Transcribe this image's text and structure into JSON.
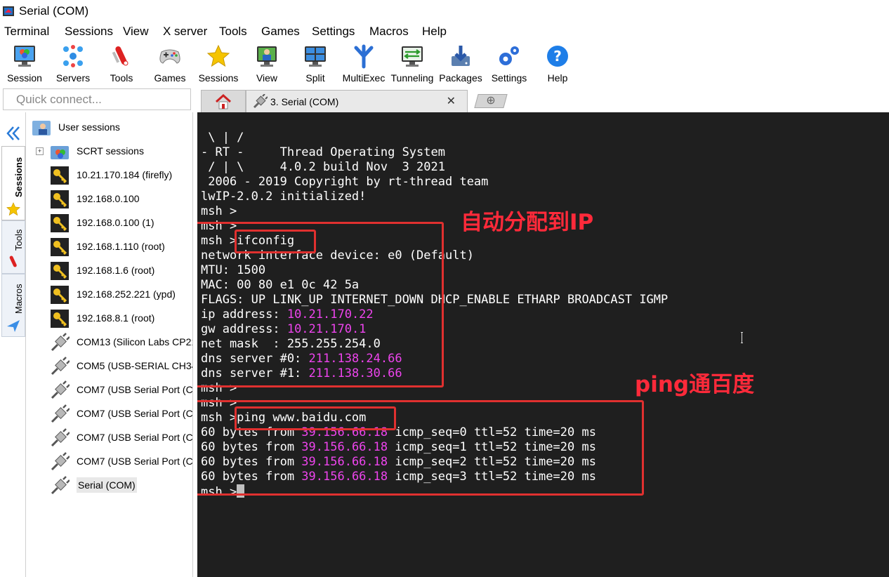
{
  "window": {
    "title": "Serial (COM)"
  },
  "menu": [
    "Terminal",
    "Sessions",
    "View",
    "X server",
    "Tools",
    "Games",
    "Settings",
    "Macros",
    "Help"
  ],
  "toolbar": [
    {
      "label": "Session",
      "icon": "monitor-icon"
    },
    {
      "label": "Servers",
      "icon": "servers-icon"
    },
    {
      "label": "Tools",
      "icon": "tools-icon"
    },
    {
      "label": "Games",
      "icon": "gamepad-icon"
    },
    {
      "label": "Sessions",
      "icon": "star-icon"
    },
    {
      "label": "View",
      "icon": "view-icon"
    },
    {
      "label": "Split",
      "icon": "split-icon"
    },
    {
      "label": "MultiExec",
      "icon": "multiexec-icon"
    },
    {
      "label": "Tunneling",
      "icon": "tunneling-icon"
    },
    {
      "label": "Packages",
      "icon": "packages-icon"
    },
    {
      "label": "Settings",
      "icon": "gears-icon"
    },
    {
      "label": "Help",
      "icon": "help-icon"
    }
  ],
  "quick_connect": {
    "placeholder": "Quick connect..."
  },
  "tabs": {
    "active_label": "3. Serial (COM)",
    "close_glyph": "✕",
    "add_glyph": "⊕"
  },
  "side_tabs": [
    "Sessions",
    "Tools",
    "Macros"
  ],
  "sessions": {
    "user_sessions": "User sessions",
    "items": [
      {
        "label": "SCRT sessions",
        "icon": "folder-icon"
      },
      {
        "label": "10.21.170.184 (firefly)",
        "icon": "key-icon"
      },
      {
        "label": "192.168.0.100",
        "icon": "key-icon"
      },
      {
        "label": "192.168.0.100 (1)",
        "icon": "key-icon"
      },
      {
        "label": "192.168.1.110 (root)",
        "icon": "key-icon"
      },
      {
        "label": "192.168.1.6 (root)",
        "icon": "key-icon"
      },
      {
        "label": "192.168.252.221 (ypd)",
        "icon": "key-icon"
      },
      {
        "label": "192.168.8.1 (root)",
        "icon": "key-icon"
      },
      {
        "label": "COM13  (Silicon Labs CP21",
        "icon": "plug-icon"
      },
      {
        "label": "COM5  (USB-SERIAL CH34",
        "icon": "plug-icon"
      },
      {
        "label": "COM7  (USB Serial Port (CO",
        "icon": "plug-icon"
      },
      {
        "label": "COM7  (USB Serial Port (CO",
        "icon": "plug-icon"
      },
      {
        "label": "COM7  (USB Serial Port (CO",
        "icon": "plug-icon"
      },
      {
        "label": "COM7  (USB Serial Port (CO",
        "icon": "plug-icon"
      },
      {
        "label": "Serial (COM)",
        "icon": "plug-icon"
      }
    ]
  },
  "terminal": {
    "lines": [
      [
        {
          "t": " \\ | /"
        }
      ],
      [
        {
          "t": "- RT -     Thread Operating System"
        }
      ],
      [
        {
          "t": " / | \\     4.0.2 build Nov  3 2021"
        }
      ],
      [
        {
          "t": " 2006 - 2019 Copyright by rt-thread team"
        }
      ],
      [
        {
          "t": "lwIP-2.0.2 initialized!"
        }
      ],
      [
        {
          "t": "msh >"
        }
      ],
      [
        {
          "t": "msh >"
        }
      ],
      [
        {
          "t": "msh >ifconfig"
        }
      ],
      [
        {
          "t": "network interface device: e0 (Default)"
        }
      ],
      [
        {
          "t": "MTU: 1500"
        }
      ],
      [
        {
          "t": "MAC: 00 80 e1 0c 42 5a"
        }
      ],
      [
        {
          "t": "FLAGS: UP LINK_UP INTERNET_DOWN DHCP_ENABLE ETHARP BROADCAST IGMP"
        }
      ],
      [
        {
          "t": "ip address: "
        },
        {
          "t": "10.21.170.22",
          "c": "mag"
        }
      ],
      [
        {
          "t": "gw address: "
        },
        {
          "t": "10.21.170.1",
          "c": "mag"
        }
      ],
      [
        {
          "t": "net mask  : 255.255.254.0"
        }
      ],
      [
        {
          "t": "dns server #0: "
        },
        {
          "t": "211.138.24.66",
          "c": "mag"
        }
      ],
      [
        {
          "t": "dns server #1: "
        },
        {
          "t": "211.138.30.66",
          "c": "mag"
        }
      ],
      [
        {
          "t": "msh >"
        }
      ],
      [
        {
          "t": "msh >"
        }
      ],
      [
        {
          "t": "msh >ping www.baidu.com"
        }
      ],
      [
        {
          "t": "60 bytes from "
        },
        {
          "t": "39.156.66.18",
          "c": "mag"
        },
        {
          "t": " icmp_seq=0 ttl=52 time=20 ms"
        }
      ],
      [
        {
          "t": "60 bytes from "
        },
        {
          "t": "39.156.66.18",
          "c": "mag"
        },
        {
          "t": " icmp_seq=1 ttl=52 time=20 ms"
        }
      ],
      [
        {
          "t": "60 bytes from "
        },
        {
          "t": "39.156.66.18",
          "c": "mag"
        },
        {
          "t": " icmp_seq=2 ttl=52 time=20 ms"
        }
      ],
      [
        {
          "t": "60 bytes from "
        },
        {
          "t": "39.156.66.18",
          "c": "mag"
        },
        {
          "t": " icmp_seq=3 ttl=52 time=20 ms"
        }
      ],
      [
        {
          "t": "msh >"
        },
        {
          "cursor": true
        }
      ]
    ]
  },
  "annotations": {
    "auto_ip": "自动分配到IP",
    "ping": "ping通百度"
  },
  "colors": {
    "terminal_bg": "#1f1f1f",
    "highlight": "#ee44ee",
    "annotation": "#ff2a3a"
  }
}
